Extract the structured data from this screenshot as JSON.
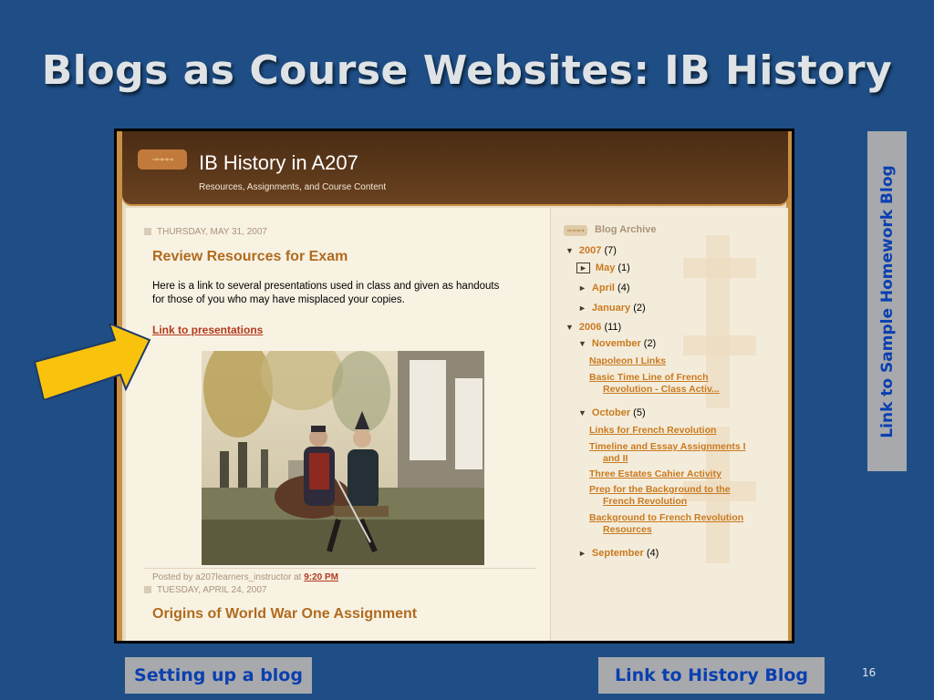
{
  "slide": {
    "title": "Blogs as Course Websites: IB History",
    "number": "16"
  },
  "blog": {
    "title": "IB History in A207",
    "description": "Resources, Assignments, and Course Content",
    "logo_glyph": "→→→→"
  },
  "posts": [
    {
      "date": "THURSDAY, MAY 31, 2007",
      "title": "Review Resources for Exam",
      "body_line1": "Here is a link to several presentations used in class and given as handouts",
      "body_line2": "for those of you who may have misplaced your copies.",
      "link": "Link to presentations",
      "posted_by": "Posted by a207learners_instructor at",
      "time": "9:20 PM"
    },
    {
      "date": "TUESDAY, APRIL 24, 2007",
      "title": "Origins of World War One Assignment"
    }
  ],
  "archive": {
    "heading": "Blog Archive",
    "tag": "→→→→",
    "year_2007": {
      "twisty": "▼",
      "label": "2007",
      "count": "(7)"
    },
    "months_2007": [
      {
        "twisty": "►",
        "label": "May",
        "count": "(1)"
      },
      {
        "twisty": "►",
        "label": "April",
        "count": "(4)"
      },
      {
        "twisty": "►",
        "label": "January",
        "count": "(2)"
      }
    ],
    "year_2006": {
      "twisty": "▼",
      "label": "2006",
      "count": "(11)"
    },
    "november": {
      "twisty": "▼",
      "label": "November",
      "count": "(2)"
    },
    "november_posts": [
      {
        "line1": "Napoleon I Links",
        "line2": ""
      },
      {
        "line1": "Basic Time Line of French",
        "line2": "Revolution - Class Activ..."
      }
    ],
    "october": {
      "twisty": "▼",
      "label": "October",
      "count": "(5)"
    },
    "october_posts": [
      {
        "line1": "Links for French Revolution",
        "line2": ""
      },
      {
        "line1": "Timeline and Essay Assignments I",
        "line2": "and II"
      },
      {
        "line1": "Three Estates Cahier Activity",
        "line2": ""
      },
      {
        "line1": "Prep for the Background to the",
        "line2": "French Revolution"
      },
      {
        "line1": "Background to French Revolution",
        "line2": "Resources"
      }
    ],
    "september": {
      "twisty": "►",
      "label": "September",
      "count": "(4)"
    }
  },
  "links": {
    "vertical": "Link to Sample Homework Blog",
    "setup": "Setting up a blog",
    "history": "Link to History Blog"
  },
  "colors": {
    "background": "#1f4e86",
    "link_text": "#0b3fb0",
    "button_bg": "#a7a9ac",
    "arrow": "#f9c30d"
  }
}
